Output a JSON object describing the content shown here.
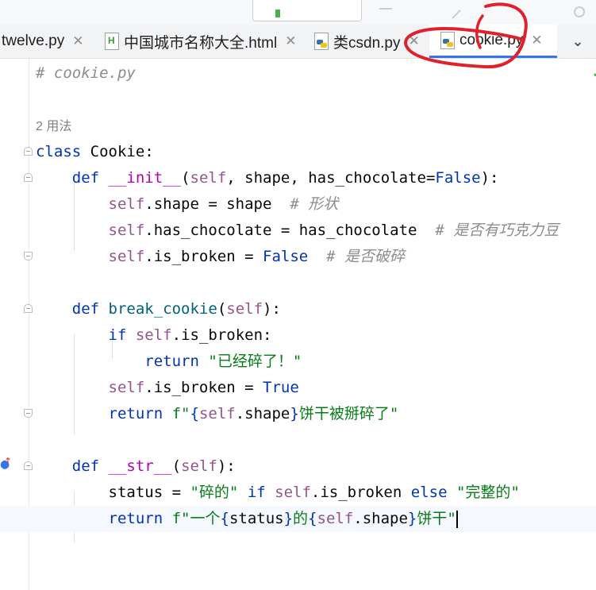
{
  "tabs": [
    {
      "label": "twelve.py",
      "icon": "python-file-icon",
      "active": false
    },
    {
      "label": "中国城市名称大全.html",
      "icon": "html-file-icon",
      "active": false
    },
    {
      "label": "类csdn.py",
      "icon": "python-file-icon",
      "active": false
    },
    {
      "label": "cookie.py",
      "icon": "python-file-icon",
      "active": true
    }
  ],
  "tab_close_glyph": "✕",
  "tab_overflow_glyph": "⌄",
  "editor": {
    "file_comment": "# cookie.py",
    "usage_hint": "2 用法",
    "class_kw": "class",
    "class_name": "Cookie",
    "lines": {
      "l1_kw": "def",
      "l1_fn": "__init__",
      "l1_params_a": "(",
      "l1_self": "self",
      "l1_params_b": ", shape, has_chocolate=",
      "l1_false": "False",
      "l1_params_c": "):",
      "l2_self": "self",
      "l2_code": ".shape = shape  ",
      "l2_comment": "# 形状",
      "l3_self": "self",
      "l3_code": ".has_chocolate = has_chocolate  ",
      "l3_comment": "# 是否有巧克力豆",
      "l4_self": "self",
      "l4_code": ".is_broken = ",
      "l4_false": "False",
      "l4_comment": "  # 是否破碎",
      "l5_kw": "def",
      "l5_fn": "break_cookie",
      "l5_a": "(",
      "l5_self": "self",
      "l5_b": "):",
      "l6_kw": "if",
      "l6_self": "self",
      "l6_code": ".is_broken:",
      "l7_kw": "return",
      "l7_str": "\"已经碎了！\"",
      "l8_self": "self",
      "l8_code": ".is_broken = ",
      "l8_true": "True",
      "l9_kw": "return",
      "l9_str_a": "f\"",
      "l9_brace_a": "{",
      "l9_self": "self",
      "l9_attr": ".shape",
      "l9_brace_b": "}",
      "l9_str_b": "饼干被掰碎了\"",
      "l10_kw": "def",
      "l10_fn": "__str__",
      "l10_a": "(",
      "l10_self": "self",
      "l10_b": "):",
      "l11_code": "status = ",
      "l11_str_a": "\"碎的\"",
      "l11_if": "if",
      "l11_self": "self",
      "l11_code_b": ".is_broken ",
      "l11_else": "else",
      "l11_str_b": "\"完整的\"",
      "l12_kw": "return",
      "l12_str_a": "f\"一个",
      "l12_brace_a": "{",
      "l12_var": "status",
      "l12_brace_b": "}",
      "l12_str_b": "的",
      "l12_brace_c": "{",
      "l12_self": "self",
      "l12_attr": ".shape",
      "l12_brace_d": "}",
      "l12_str_c": "饼干\""
    }
  },
  "colors": {
    "keyword": "#0033b3",
    "self": "#94558d",
    "function": "#00627a",
    "dunder": "#b200b2",
    "string": "#067d17",
    "comment": "#8c8c8c",
    "annotation": "#e0202a",
    "active_tab_underline": "#3574f0"
  }
}
